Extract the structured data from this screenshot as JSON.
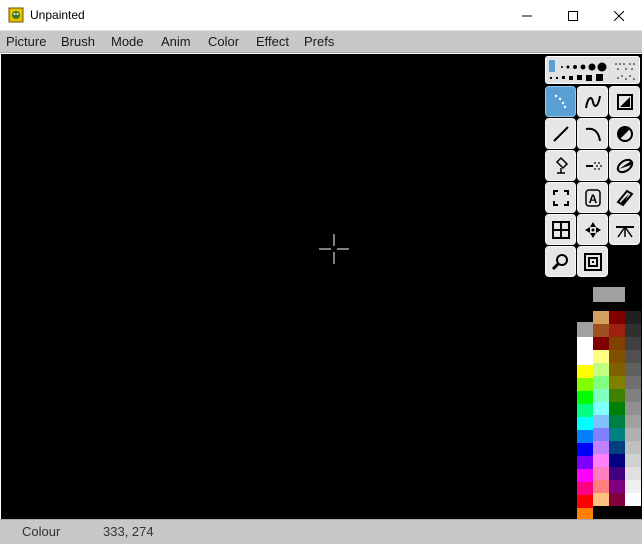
{
  "window": {
    "title": "Unpainted",
    "icon": "paint-app-icon",
    "controls": [
      "minimize-icon",
      "maximize-icon",
      "close-icon"
    ]
  },
  "menu": [
    {
      "label": "Picture"
    },
    {
      "label": "Brush"
    },
    {
      "label": "Mode"
    },
    {
      "label": "Anim"
    },
    {
      "label": "Color"
    },
    {
      "label": "Effect"
    },
    {
      "label": "Prefs"
    }
  ],
  "canvas": {
    "background": "#000000",
    "cursor": "crosshair-cursor"
  },
  "tools": [
    {
      "name": "freehand-dots-tool",
      "active": true
    },
    {
      "name": "freehand-line-tool",
      "active": false
    },
    {
      "name": "filled-rectangle-tool",
      "active": false
    },
    {
      "name": "straight-line-tool",
      "active": false
    },
    {
      "name": "curve-tool",
      "active": false
    },
    {
      "name": "filled-circle-tool",
      "active": false
    },
    {
      "name": "fill-bucket-tool",
      "active": false
    },
    {
      "name": "airbrush-tool",
      "active": false
    },
    {
      "name": "filled-ellipse-tool",
      "active": false
    },
    {
      "name": "brush-select-tool",
      "active": false
    },
    {
      "name": "text-tool",
      "active": false
    },
    {
      "name": "filled-polygon-tool",
      "active": false
    },
    {
      "name": "grid-tool",
      "active": false
    },
    {
      "name": "symmetry-tool",
      "active": false
    },
    {
      "name": "perspective-tool",
      "active": false
    },
    {
      "name": "magnify-tool",
      "active": false
    },
    {
      "name": "frame-tool",
      "active": false
    }
  ],
  "palette": {
    "foreground": "#ffffff",
    "background": "#a0a0a0",
    "selected": "#a0a0a0",
    "columns": [
      [
        "#ffffff",
        "#ffff00",
        "#80ff00",
        "#00ff00",
        "#00ff80",
        "#00ffff",
        "#0080ff",
        "#0000ff",
        "#8000ff",
        "#ff00ff",
        "#ff0080",
        "#ff0000",
        "#ff8000"
      ],
      [
        "#d4a060",
        "#a05020",
        "#800000",
        "#ffff80",
        "#c0ff80",
        "#80ff80",
        "#80ffc0",
        "#80ffff",
        "#80c0ff",
        "#8080ff",
        "#c080ff",
        "#ff80ff",
        "#ff80c0",
        "#ff8080",
        "#ffc080"
      ],
      [
        "#800000",
        "#a02010",
        "#804000",
        "#805000",
        "#806000",
        "#808000",
        "#408000",
        "#008000",
        "#008040",
        "#008080",
        "#004080",
        "#000080",
        "#400080",
        "#800080",
        "#800040"
      ],
      [
        "#202020",
        "#303030",
        "#404040",
        "#505050",
        "#606060",
        "#707070",
        "#808080",
        "#909090",
        "#a0a0a0",
        "#b0b0b0",
        "#c0c0c0",
        "#d0d0d0",
        "#e0e0e0",
        "#f0f0f0",
        "#ffffff"
      ]
    ]
  },
  "status": {
    "label": "Colour",
    "coords": "333, 274"
  }
}
